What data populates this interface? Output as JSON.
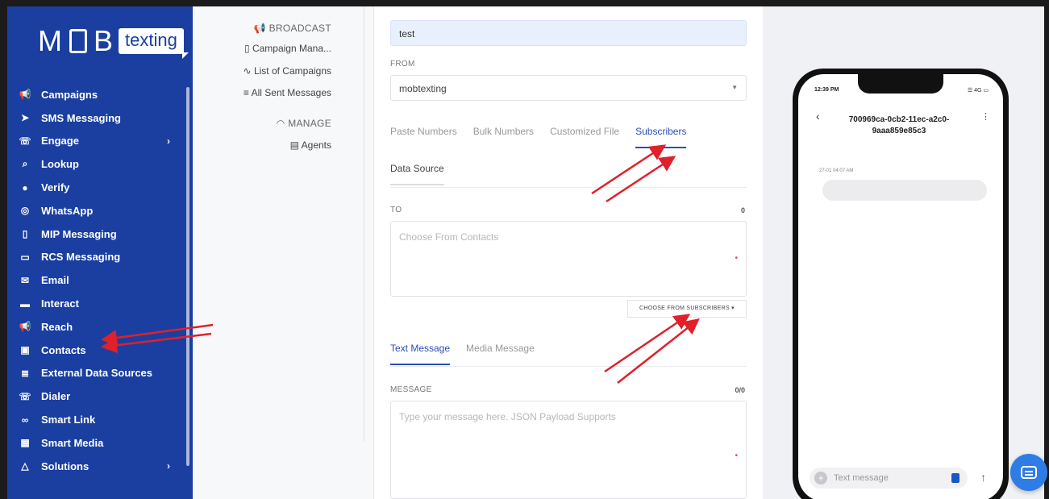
{
  "logo": {
    "left": "M",
    "right_box": "B",
    "tag": "texting"
  },
  "sidebar": {
    "items": [
      {
        "label": "Campaigns",
        "icon": "megaphone-icon",
        "glyph": "📢"
      },
      {
        "label": "SMS Messaging",
        "icon": "send-icon",
        "glyph": "➤"
      },
      {
        "label": "Engage",
        "icon": "phone-icon",
        "glyph": "☏",
        "chevron": "›"
      },
      {
        "label": "Lookup",
        "icon": "search-icon",
        "glyph": "⌕"
      },
      {
        "label": "Verify",
        "icon": "shield-icon",
        "glyph": "●"
      },
      {
        "label": "WhatsApp",
        "icon": "whatsapp-icon",
        "glyph": "◎"
      },
      {
        "label": "MIP Messaging",
        "icon": "mobile-icon",
        "glyph": "▯"
      },
      {
        "label": "RCS Messaging",
        "icon": "chat-icon",
        "glyph": "▭"
      },
      {
        "label": "Email",
        "icon": "email-icon",
        "glyph": "✉"
      },
      {
        "label": "Interact",
        "icon": "ticket-icon",
        "glyph": "▬"
      },
      {
        "label": "Reach",
        "icon": "megaphone-icon",
        "glyph": "📢"
      },
      {
        "label": "Contacts",
        "icon": "contacts-icon",
        "glyph": "▣"
      },
      {
        "label": "External Data Sources",
        "icon": "database-icon",
        "glyph": "≣"
      },
      {
        "label": "Dialer",
        "icon": "phone-icon",
        "glyph": "☏"
      },
      {
        "label": "Smart Link",
        "icon": "link-icon",
        "glyph": "∞"
      },
      {
        "label": "Smart Media",
        "icon": "media-icon",
        "glyph": "▦"
      },
      {
        "label": "Solutions",
        "icon": "triangle-icon",
        "glyph": "△",
        "chevron": "›"
      }
    ]
  },
  "submenu": {
    "broadcast": "BROADCAST",
    "broadcast_glyph": "📢",
    "campaign_manager": "Campaign Mana...",
    "campaign_manager_glyph": "▯",
    "list_of_campaigns": "List of Campaigns",
    "list_of_campaigns_glyph": "∿",
    "all_sent_messages": "All Sent Messages",
    "all_sent_messages_glyph": "≡",
    "manage": "MANAGE",
    "manage_glyph": "◠",
    "agents": "Agents",
    "agents_glyph": "▤"
  },
  "form": {
    "campaign_value": "test",
    "from_label": "FROM",
    "from_value": "mobtexting",
    "source_tabs": [
      "Paste Numbers",
      "Bulk Numbers",
      "Customized File",
      "Subscribers"
    ],
    "active_source_tab": "Subscribers",
    "data_source_tab": "Data Source",
    "to_label": "TO",
    "to_count": "0",
    "to_placeholder": "Choose From Contacts",
    "required_mark": "•",
    "choose_button": "CHOOSE FROM SUBSCRIBERS ▾",
    "message_tabs": [
      "Text Message",
      "Media Message"
    ],
    "active_message_tab": "Text Message",
    "message_label": "MESSAGE",
    "message_count": "0/0",
    "message_placeholder": "Type your message here. JSON Payload Supports"
  },
  "preview": {
    "time": "12:39 PM",
    "status": "☰ 4G ▭",
    "back": "‹",
    "title": "700969ca-0cb2-11ec-a2c0-9aaa859e85c3",
    "menu": "⋮",
    "timestamp": "27-01 04:07 AM",
    "composer_plus": "+",
    "composer_placeholder": "Text message",
    "send": "↑"
  },
  "colors": {
    "sidebar": "#1a3fa0",
    "accent": "#2b4db8",
    "annotation": "#e0202a",
    "fab": "#2e7ce6"
  }
}
